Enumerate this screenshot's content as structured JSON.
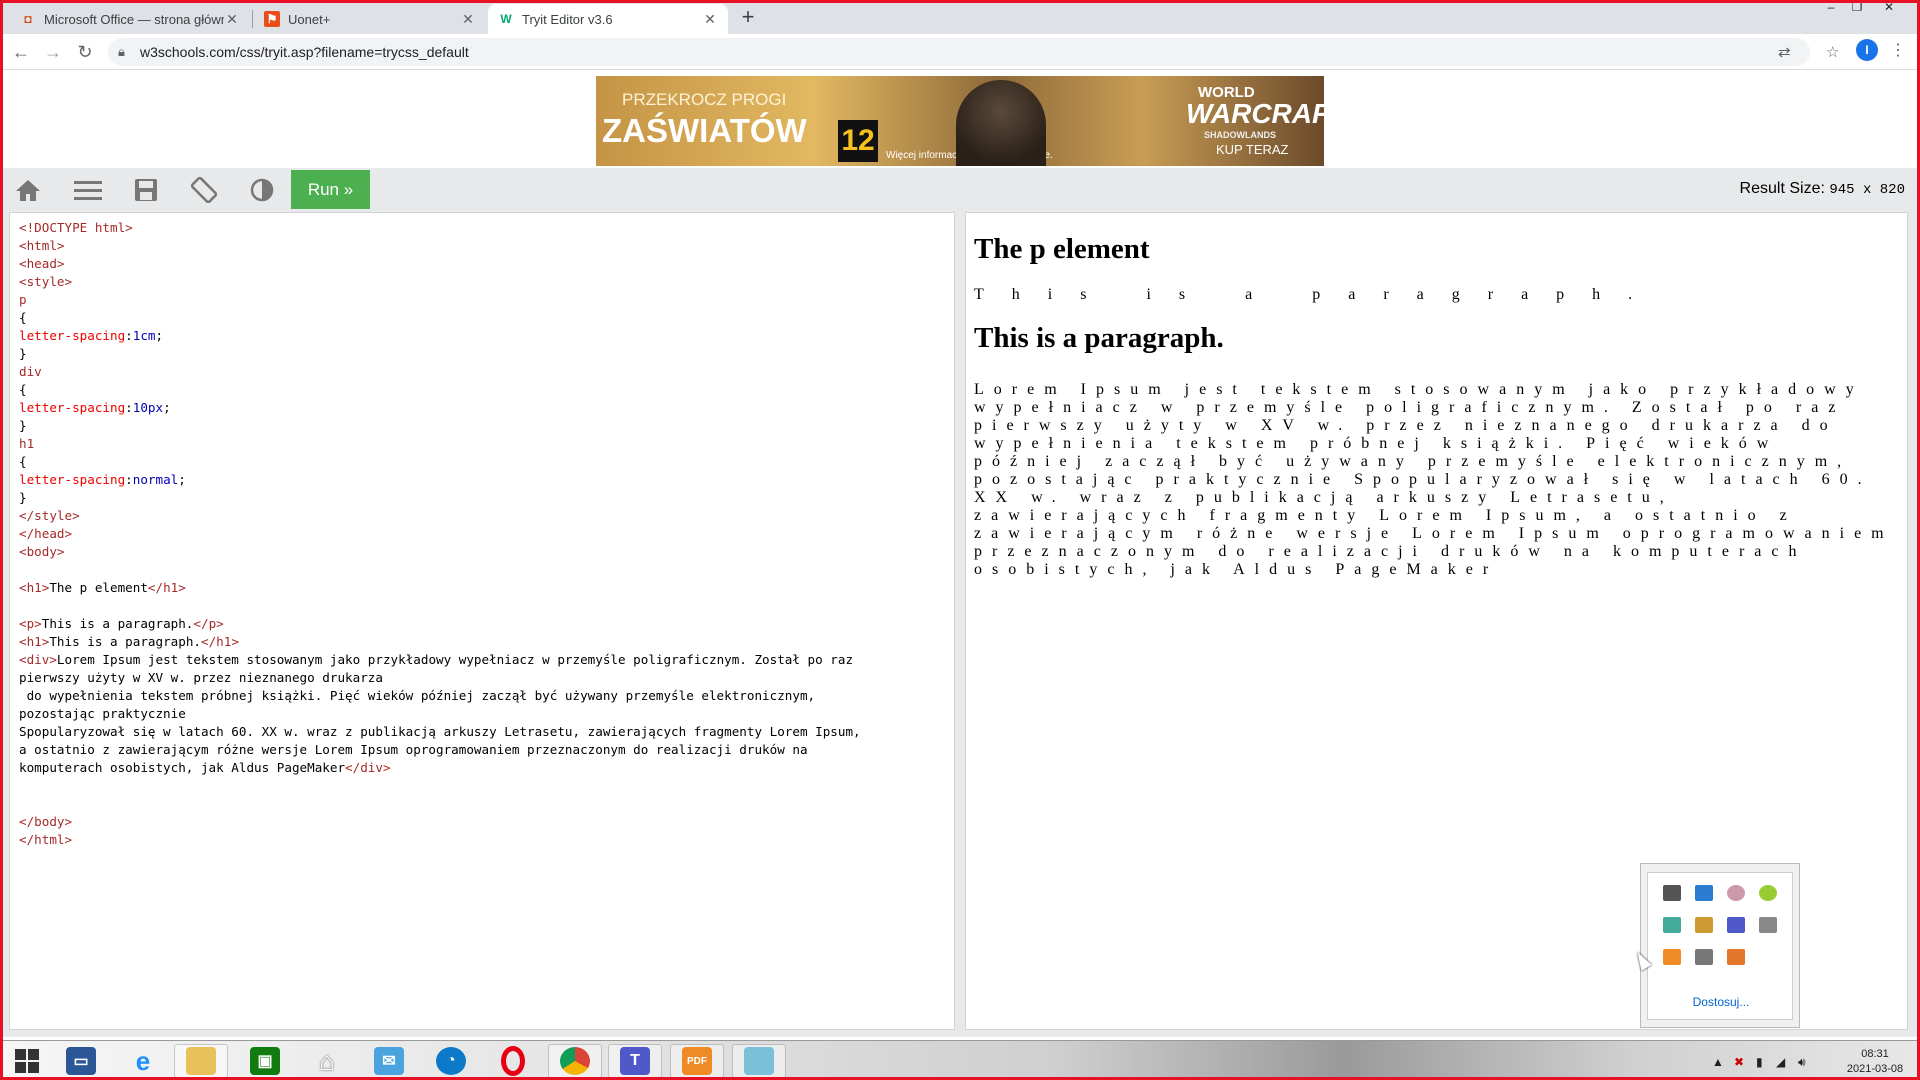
{
  "browser": {
    "tabs": [
      {
        "title": "Microsoft Office — strona główna",
        "icon": "office-icon",
        "active": false
      },
      {
        "title": "Uonet+",
        "icon": "uonet-icon",
        "active": false
      },
      {
        "title": "Tryit Editor v3.6",
        "icon": "w3schools-icon",
        "active": true
      }
    ],
    "url": "w3schools.com/css/tryit.asp?filename=trycss_default",
    "profile_initial": "I"
  },
  "ad": {
    "line1": "PRZEKROCZ PROGI",
    "line2": "ZAŚWIATÓW",
    "age": "12",
    "info": "Więcej informacji na oficjalnej stronie.",
    "logo_top": "WORLD",
    "logo_main": "WARCRAFT",
    "logo_sub": "SHADOWLANDS",
    "cta": "KUP TERAZ"
  },
  "tryit": {
    "run_label": "Run »",
    "result_size_label": "Result Size:",
    "result_size_value": "945 x 820",
    "accent_color": "#4caf50"
  },
  "code_lines": [
    "<!DOCTYPE html>",
    "<html>",
    "<head>",
    "<style>",
    "p",
    "{",
    "letter-spacing:1cm;",
    "}",
    "div",
    "{",
    "letter-spacing:10px;",
    "}",
    "h1",
    "{",
    "letter-spacing:normal;",
    "}",
    "</style>",
    "</head>",
    "<body>",
    "",
    "<h1>The p element</h1>",
    "",
    "<p>This is a paragraph.</p>",
    "<h1>This is a paragraph.</h1>",
    "<div>Lorem Ipsum jest tekstem stosowanym jako przykładowy wypełniacz w przemyśle poligraficznym. Został po raz",
    "pierwszy użyty w XV w. przez nieznanego drukarza",
    " do wypełnienia tekstem próbnej książki. Pięć wieków później zaczął być używany przemyśle elektronicznym,",
    "pozostając praktycznie",
    "Spopularyzował się w latach 60. XX w. wraz z publikacją arkuszy Letrasetu, zawierających fragmenty Lorem Ipsum,",
    "a ostatnio z zawierającym różne wersje Lorem Ipsum oprogramowaniem przeznaczonym do realizacji druków na",
    "komputerach osobistych, jak Aldus PageMaker</div>",
    "",
    "",
    "</body>",
    "</html>"
  ],
  "result": {
    "h1_first": "The p element",
    "paragraph": "This is a paragraph.",
    "h1_second": "This is a paragraph.",
    "div_text": "Lorem Ipsum jest tekstem stosowanym jako przykładowy wypełniacz w przemyśle poligraficznym. Został po raz pierwszy użyty w XV w. przez nieznanego drukarza do wypełnienia tekstem próbnej książki. Pięć wieków później zaczął być używany przemyśle elektronicznym, pozostając praktycznie Spopularyzował się w latach 60. XX w. wraz z publikacją arkuszy Letrasetu, zawierających fragmenty Lorem Ipsum, a ostatnio z zawierającym różne wersje Lorem Ipsum oprogramowaniem przeznaczonym do realizacji druków na komputerach osobistych, jak Aldus PageMaker"
  },
  "tray": {
    "customize_label": "Dostosuj..."
  },
  "taskbar": {
    "time": "08:31",
    "date": "2021-03-08",
    "pdf_label": "PDF"
  }
}
